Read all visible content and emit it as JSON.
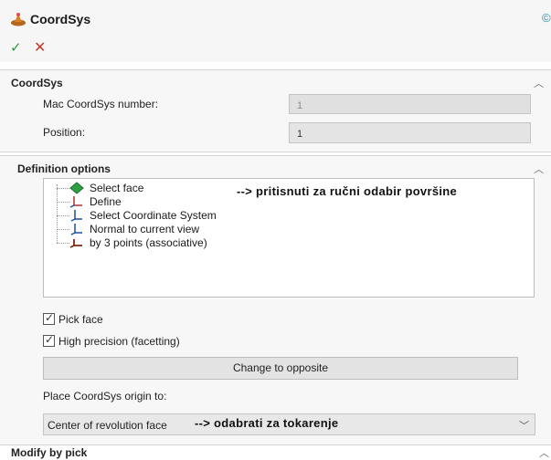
{
  "window": {
    "title": "CoordSys",
    "help_icon": "help-icon"
  },
  "toolbar": {
    "ok": "✓",
    "cancel": "✕"
  },
  "coordsys_panel": {
    "title": "CoordSys",
    "mac_label": "Mac CoordSys number:",
    "mac_value": "1",
    "position_label": "Position:",
    "position_value": "1"
  },
  "definition_panel": {
    "title": "Definition options",
    "items": [
      {
        "label": "Select face",
        "icon": "diamond-face-icon"
      },
      {
        "label": "Define",
        "icon": "axes-define-icon"
      },
      {
        "label": "Select Coordinate System",
        "icon": "coordsys-select-icon"
      },
      {
        "label": "Normal to current view",
        "icon": "normal-view-icon"
      },
      {
        "label": "by 3 points (associative)",
        "icon": "three-points-icon"
      }
    ],
    "annotation_select_face": "--> pritisnuti za ručni odabir površine",
    "pick_face_label": "Pick face",
    "pick_face_checked": true,
    "high_precision_label": "High precision (facetting)",
    "high_precision_checked": true,
    "change_button": "Change to opposite",
    "origin_label": "Place CoordSys origin to:",
    "origin_value": "Center of revolution face",
    "origin_annotation": "--> odabrati za tokarenje"
  },
  "modify_panel": {
    "title": "Modify by pick"
  },
  "colors": {
    "ok": "#2e9d3a",
    "cancel": "#c0392b",
    "panel_bg": "#f7f7f7"
  }
}
